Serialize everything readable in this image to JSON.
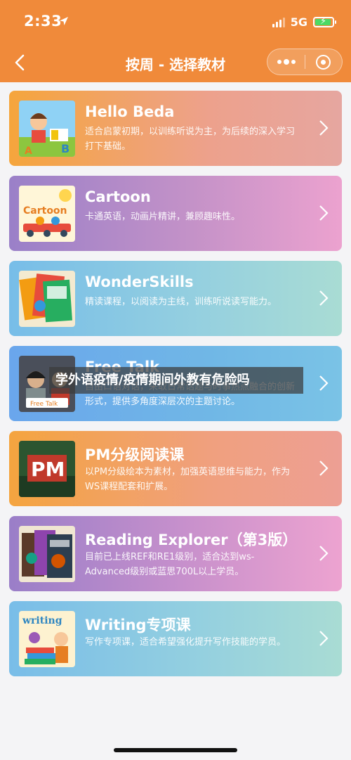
{
  "status_bar": {
    "time": "2:33",
    "network": "5G",
    "battery_level": 0.9
  },
  "nav": {
    "title": "按周 - 选择教材"
  },
  "courses": [
    {
      "title": "Hello Beda",
      "desc": "适合启蒙初期，以训练听说为主，为后续的深入学习打下基础。",
      "thumb": "hello-beda"
    },
    {
      "title": "Cartoon",
      "desc": "卡通英语，动画片精讲，兼顾趣味性。",
      "thumb": "cartoon",
      "thumb_label": "Cartoon"
    },
    {
      "title": "WonderSkills",
      "desc": "精读课程，以阅读为主线，训练听说读写能力。",
      "thumb": "wonderskills"
    },
    {
      "title": "Free Talk",
      "desc": "自由口语对话，采取日常话题与时事热点融合的创新形式，提供多角度深层次的主题讨论。",
      "thumb": "free-talk",
      "thumb_label": "Free Talk"
    },
    {
      "title": "PM分级阅读课",
      "desc": "以PM分级绘本为素材，加强英语思维与能力，作为WS课程配套和扩展。",
      "thumb": "pm",
      "thumb_label": "PM"
    },
    {
      "title": "Reading Explorer（第3版）",
      "desc": "目前已上线REF和RE1级别，适合达到ws-Advanced级别或蓝思700L以上学员。",
      "thumb": "reading-explorer"
    },
    {
      "title": "Writing专项课",
      "desc": "写作专项课，适合希望强化提升写作技能的学员。",
      "thumb": "writing",
      "thumb_label": "writing"
    }
  ],
  "overlay_caption": "学外语疫情/疫情期间外教有危险吗",
  "colors": {
    "nav_bg": "#f08a3a",
    "text": "#ffffff"
  }
}
